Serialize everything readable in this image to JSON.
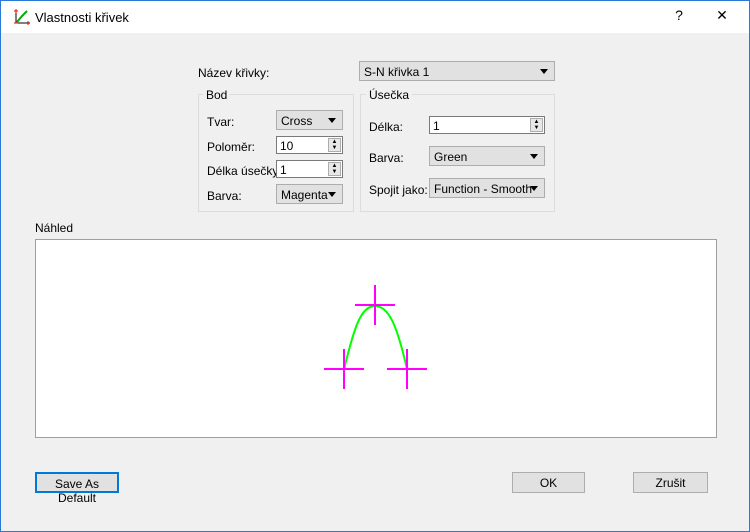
{
  "window": {
    "title": "Vlastnosti křivek",
    "help": "?",
    "close": "✕"
  },
  "curve_name": {
    "label": "Název křivky:",
    "value": "S-N křivka 1"
  },
  "point": {
    "title": "Bod",
    "shape_label": "Tvar:",
    "shape": "Cross",
    "radius_label": "Poloměr:",
    "radius": "10",
    "seg_len_label": "Délka úsečky",
    "seg_len": "1",
    "color_label": "Barva:",
    "color": "Magenta"
  },
  "line": {
    "title": "Úsečka",
    "length_label": "Délka:",
    "length": "1",
    "color_label": "Barva:",
    "color": "Green",
    "connect_label": "Spojit jako:",
    "connect": "Function - Smooth"
  },
  "preview": {
    "label": "Náhled",
    "point_color": "#ff00ff",
    "line_color": "#00ff00"
  },
  "buttons": {
    "save_default": "Save As Default",
    "ok": "OK",
    "cancel": "Zrušit"
  }
}
